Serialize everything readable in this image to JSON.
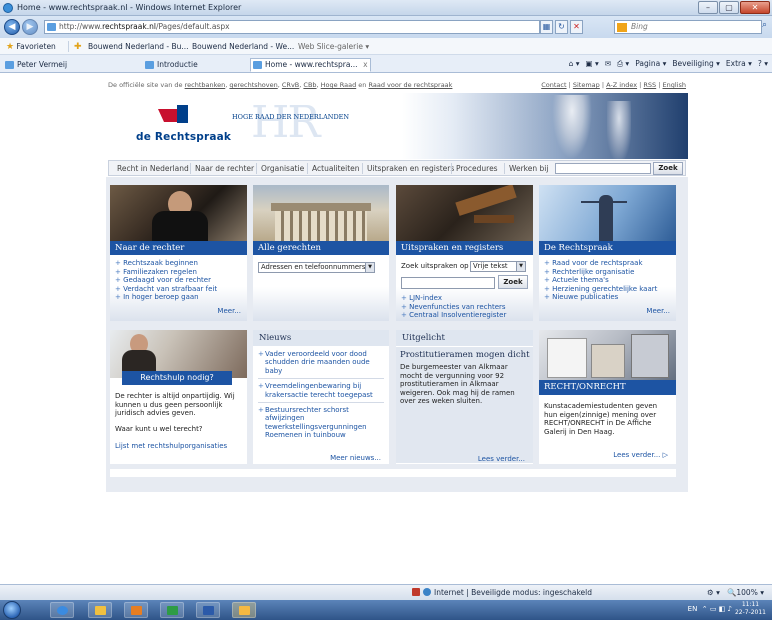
{
  "browser": {
    "title": "Home - www.rechtspraak.nl - Windows Internet Explorer",
    "window_buttons": {
      "minimize": "–",
      "maximize": "▢",
      "close": "✕"
    },
    "address_prefix": "http://www.",
    "address_domain": "rechtspraak.nl",
    "address_path": "/Pages/default.aspx",
    "search_placeholder": "Bing",
    "favorites_label": "Favorieten",
    "favorites": [
      "Bouwend Nederland - Bu...",
      "Bouwend Nederland - We...",
      "Web Slice-galerie ▾"
    ],
    "tabs": [
      "Peter Vermeij",
      "Introductie",
      "Home - www.rechtspra..."
    ],
    "tab_close": "x",
    "command_bar": [
      "Pagina ▾",
      "Beveiliging ▾",
      "Extra ▾"
    ]
  },
  "site": {
    "topline": {
      "text_before": "De officiële site van de",
      "links": [
        "rechtbanken",
        "gerechtshoven",
        "CRvB",
        "CBb",
        "Hoge Raad"
      ],
      "and_word": "en",
      "last_link": "Raad voor de rechtspraak",
      "right_links": [
        "Contact",
        "Sitemap",
        "A-Z index",
        "RSS",
        "English"
      ]
    },
    "logo_text": "de Rechtspraak",
    "hr_watermark": "HR",
    "hr_caption": "HOGE RAAD DER NEDERLANDEN",
    "nav": [
      "Recht in Nederland",
      "Naar de rechter",
      "Organisatie",
      "Actualiteiten",
      "Uitspraken en registers",
      "Procedures",
      "Werken bij"
    ],
    "nav_search_button": "Zoek",
    "cards": {
      "naar_de_rechter": {
        "title": "Naar de rechter",
        "links": [
          "Rechtszaak beginnen",
          "Familiezaken regelen",
          "Gedaagd voor de rechter",
          "Verdacht van strafbaar feit",
          "In hoger beroep gaan"
        ],
        "more": "Meer..."
      },
      "alle_gerechten": {
        "title": "Alle gerechten",
        "select_value": "Adressen en telefoonnummers"
      },
      "uitspraken": {
        "title": "Uitspraken en registers",
        "search_label": "Zoek uitspraken op",
        "select_value": "Vrije tekst",
        "button": "Zoek",
        "links": [
          "LJN-index",
          "Nevenfuncties van rechters",
          "Centraal Insolventieregister"
        ]
      },
      "de_rechtspraak": {
        "title": "De Rechtspraak",
        "links": [
          "Raad voor de rechtspraak",
          "Rechterlijke organisatie",
          "Actuele thema's",
          "Herziening gerechtelijke kaart",
          "Nieuwe publicaties"
        ],
        "more": "Meer..."
      },
      "rechtshulp": {
        "banner": "Rechtshulp nodig?",
        "text": "De rechter is altijd onpartijdig. Wij kunnen u dus geen persoonlijk juridisch advies geven.",
        "question": "Waar kunt u wel terecht?",
        "link": "Lijst met rechtshulporganisaties"
      },
      "nieuws": {
        "title": "Nieuws",
        "items": [
          "Vader veroordeeld voor dood schudden drie maanden oude baby",
          "Vreemdelingenbewaring bij krakersactie terecht toegepast",
          "Bestuursrechter schorst afwijzingen tewerkstellingsvergunningen Roemenen in tuinbouw"
        ],
        "more": "Meer nieuws..."
      },
      "uitgelicht": {
        "title": "Uitgelicht",
        "subtitle": "Prostitutieramen mogen dicht",
        "text": "De burgemeester van Alkmaar mocht de vergunning voor 92 prostitutieramen in Alkmaar weigeren. Ook mag hij de ramen over zes weken sluiten.",
        "more": "Lees verder..."
      },
      "recht_onrecht": {
        "title": "RECHT/ONRECHT",
        "text": "Kunstacademiestudenten geven hun eigen(zinnige) mening over RECHT/ONRECHT in De Affiche Galerij in Den Haag.",
        "more": "Lees verder..."
      }
    }
  },
  "statusbar": {
    "text": "Internet | Beveiligde modus: ingeschakeld",
    "zoom": "100%"
  },
  "taskbar": {
    "lang": "EN",
    "time": "11:11",
    "date": "22-7-2011"
  },
  "colors": {
    "brand_blue": "#1d54a3",
    "brand_red": "#c8102e",
    "nav_bg": "#f1f3f7"
  }
}
